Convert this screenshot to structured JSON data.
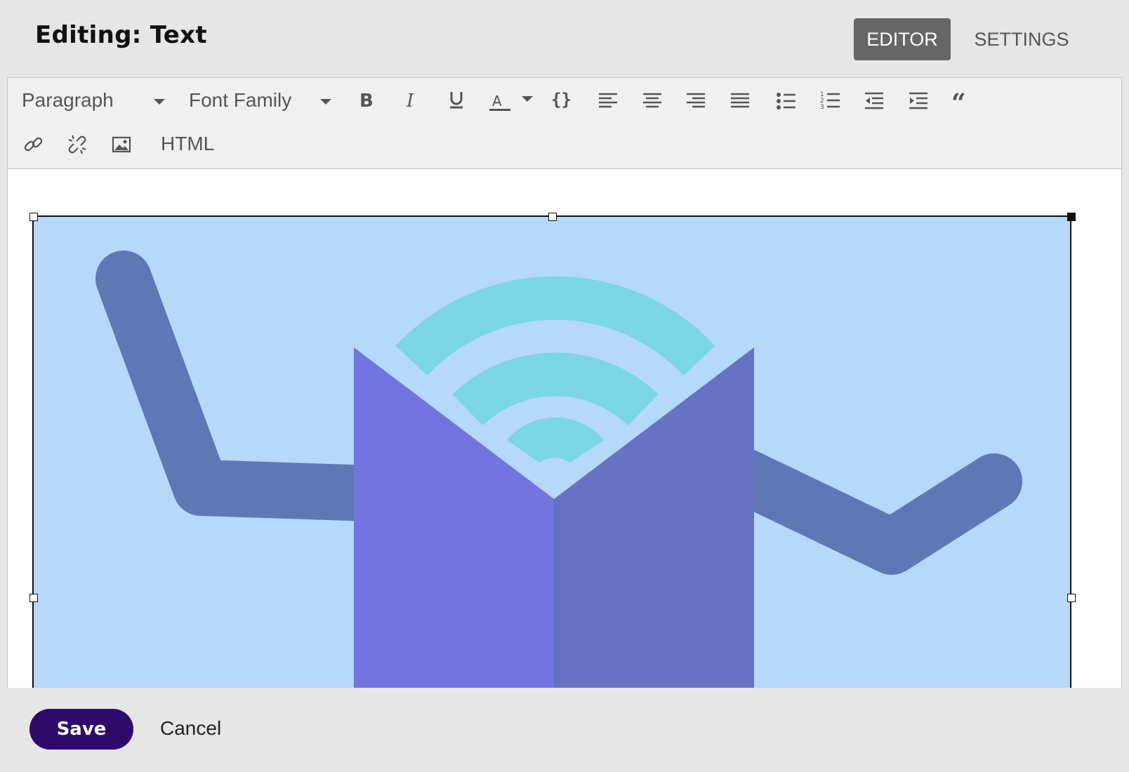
{
  "header": {
    "title": "Editing: Text",
    "tabs": [
      {
        "label": "EDITOR",
        "active": true
      },
      {
        "label": "SETTINGS",
        "active": false
      }
    ]
  },
  "toolbar": {
    "block_format": "Paragraph",
    "font_family": "Font Family",
    "icons": [
      "bold-icon",
      "italic-icon",
      "underline-icon",
      "text-color-icon",
      "code-icon",
      "align-left-icon",
      "align-center-icon",
      "align-right-icon",
      "align-justify-icon",
      "bullet-list-icon",
      "numbered-list-icon",
      "outdent-icon",
      "indent-icon",
      "blockquote-icon",
      "link-icon",
      "unlink-icon",
      "image-icon"
    ],
    "html_label": "HTML"
  },
  "content": {
    "image_icon": "podcast-book-illustration",
    "colors": {
      "background": "#b5d8fb",
      "line": "#5e78b5",
      "waves": "#7ad6e8",
      "book_left": "#7274df",
      "book_right": "#6672c4"
    }
  },
  "footer": {
    "save_label": "Save",
    "cancel_label": "Cancel"
  },
  "colors": {
    "save_button": "#2f0a6b",
    "active_tab": "#666666",
    "image_selection": "#111111"
  }
}
